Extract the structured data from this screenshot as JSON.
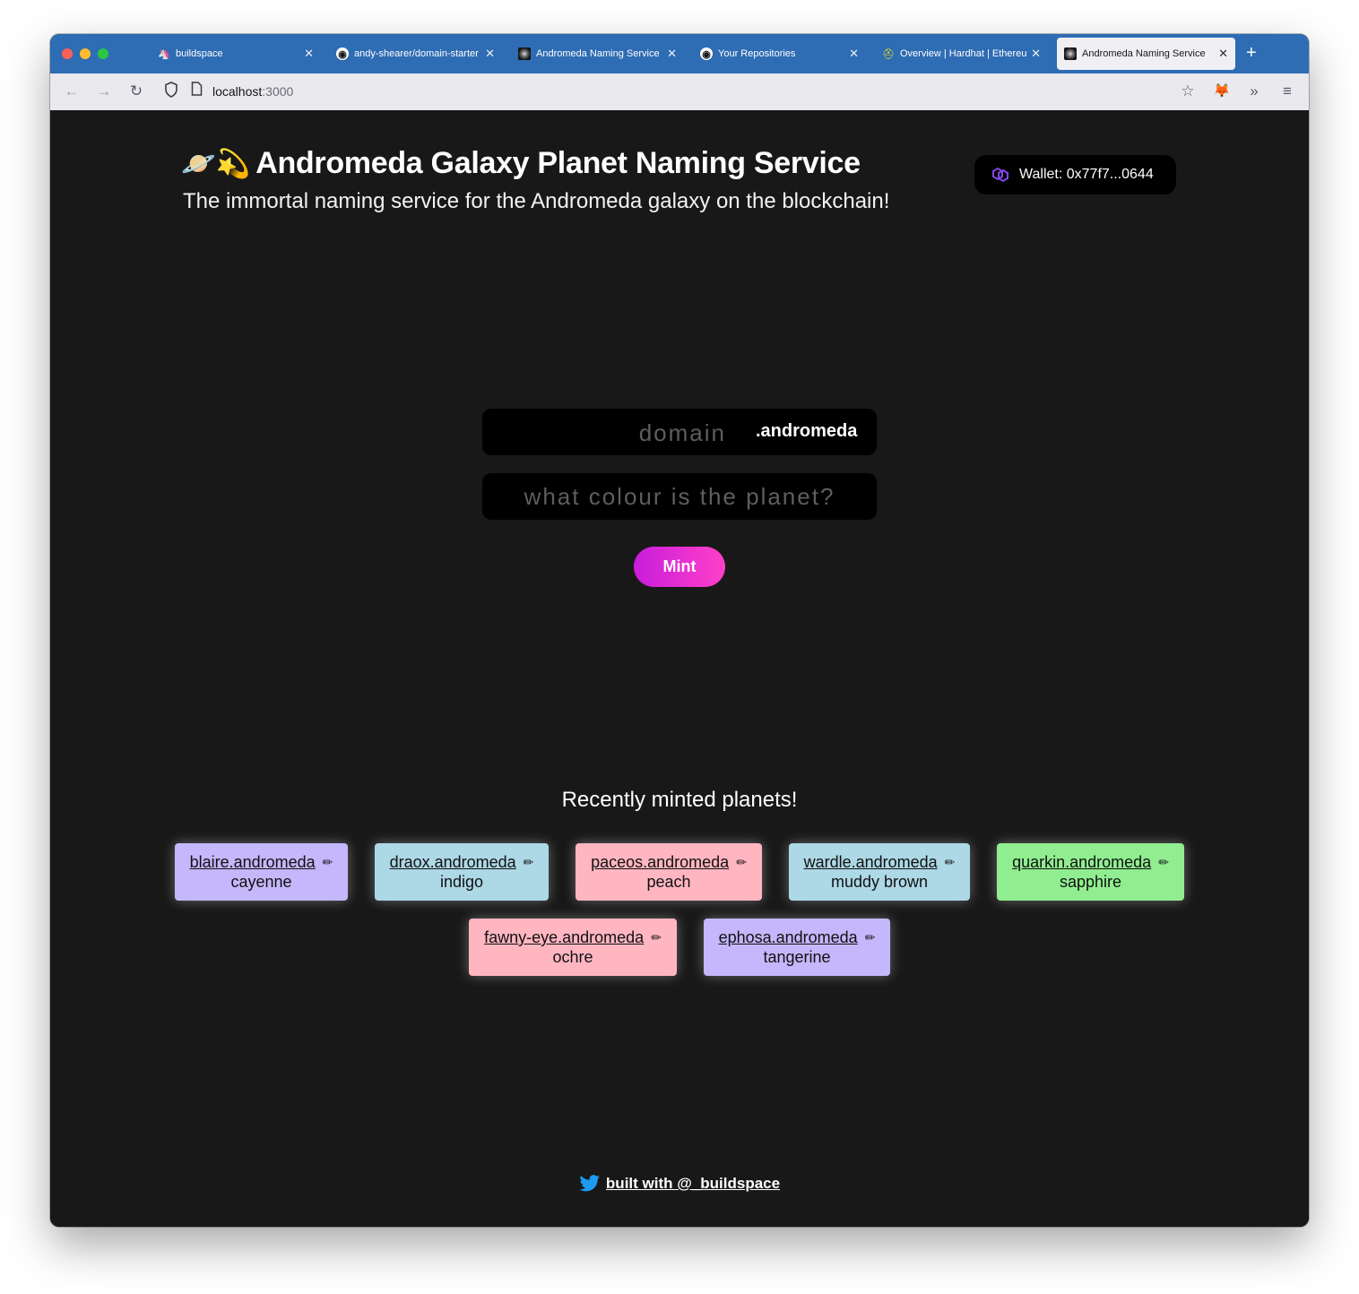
{
  "browser": {
    "tabs": [
      {
        "title": "buildspace",
        "icon": "unicorn-icon",
        "active": false
      },
      {
        "title": "andy-shearer/domain-starter",
        "icon": "github-icon",
        "active": false
      },
      {
        "title": "Andromeda Naming Service",
        "icon": "galaxy-icon",
        "active": false
      },
      {
        "title": "Your Repositories",
        "icon": "github-icon",
        "active": false
      },
      {
        "title": "Overview | Hardhat | Ethereum",
        "icon": "hardhat-icon",
        "active": false
      },
      {
        "title": "Andromeda Naming Service",
        "icon": "galaxy-icon",
        "active": true
      }
    ],
    "url_host": "localhost",
    "url_port": ":3000"
  },
  "header": {
    "emoji": "🪐💫",
    "title": "Andromeda Galaxy Planet Naming Service",
    "subtitle": "The immortal naming service for the Andromeda galaxy on the blockchain!",
    "wallet": "Wallet: 0x77f7...0644",
    "wallet_icon_color": "#8247e5"
  },
  "form": {
    "domain_placeholder": "domain",
    "tld": ".andromeda",
    "colour_placeholder": "what colour is the planet?",
    "mint_label": "Mint"
  },
  "recent": {
    "title": "Recently minted planets!",
    "cards": [
      {
        "name": "blaire.andromeda",
        "colour": "cayenne",
        "bg": "#c5b7fb"
      },
      {
        "name": "draox.andromeda",
        "colour": "indigo",
        "bg": "#add8e6"
      },
      {
        "name": "paceos.andromeda",
        "colour": "peach",
        "bg": "#ffb6c1"
      },
      {
        "name": "wardle.andromeda",
        "colour": "muddy brown",
        "bg": "#add8e6"
      },
      {
        "name": "quarkin.andromeda",
        "colour": "sapphire",
        "bg": "#90ee90"
      },
      {
        "name": "fawny-eye.andromeda",
        "colour": "ochre",
        "bg": "#ffb6c1"
      },
      {
        "name": "ephosa.andromeda",
        "colour": "tangerine",
        "bg": "#c5b7fb"
      }
    ]
  },
  "footer": {
    "link": "built with @_buildspace",
    "icon": "twitter-icon",
    "icon_color": "#1d9bf0"
  }
}
